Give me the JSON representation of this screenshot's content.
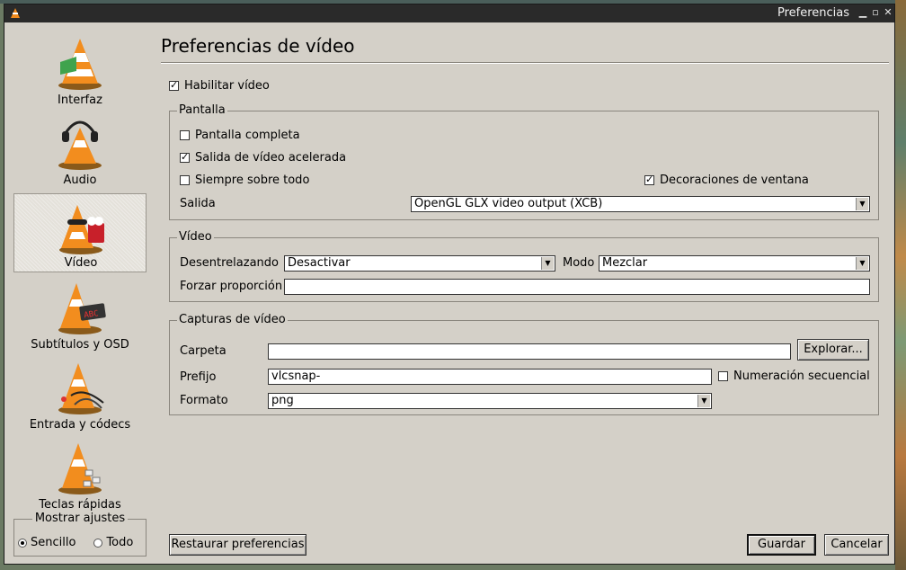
{
  "window": {
    "title": "Preferencias"
  },
  "sidebar": {
    "items": [
      {
        "label": "Interfaz",
        "icon": "vlc-cone-interface-icon"
      },
      {
        "label": "Audio",
        "icon": "vlc-cone-headphones-icon"
      },
      {
        "label": "Vídeo",
        "icon": "vlc-cone-video-icon",
        "selected": true
      },
      {
        "label": "Subtítulos y OSD",
        "icon": "vlc-cone-subtitles-icon"
      },
      {
        "label": "Entrada y códecs",
        "icon": "vlc-cone-cables-icon"
      },
      {
        "label": "Teclas rápidas",
        "icon": "vlc-cone-keys-icon"
      }
    ],
    "show_settings": {
      "legend": "Mostrar ajustes",
      "simple": "Sencillo",
      "all": "Todo",
      "selected": "simple"
    }
  },
  "main": {
    "title": "Preferencias de vídeo",
    "enable_video": {
      "label": "Habilitar vídeo",
      "checked": true
    },
    "display": {
      "legend": "Pantalla",
      "fullscreen": {
        "label": "Pantalla completa",
        "checked": false
      },
      "accelerated": {
        "label": "Salida de vídeo acelerada",
        "checked": true
      },
      "always_on_top": {
        "label": "Siempre sobre todo",
        "checked": false
      },
      "window_decorations": {
        "label": "Decoraciones de ventana",
        "checked": true
      },
      "output_label": "Salida",
      "output_value": "OpenGL GLX video output (XCB)"
    },
    "video": {
      "legend": "Vídeo",
      "deinterlace_label": "Desentrelazando",
      "deinterlace_value": "Desactivar",
      "mode_label": "Modo",
      "mode_value": "Mezclar",
      "aspect_label": "Forzar proporción",
      "aspect_value": ""
    },
    "snapshots": {
      "legend": "Capturas de vídeo",
      "folder_label": "Carpeta",
      "folder_value": "",
      "browse_label": "Explorar...",
      "prefix_label": "Prefijo",
      "prefix_value": "vlcsnap-",
      "sequential": {
        "label": "Numeración secuencial",
        "checked": false
      },
      "format_label": "Formato",
      "format_value": "png"
    }
  },
  "footer": {
    "reset": "Restaurar preferencias",
    "save": "Guardar",
    "cancel": "Cancelar"
  }
}
